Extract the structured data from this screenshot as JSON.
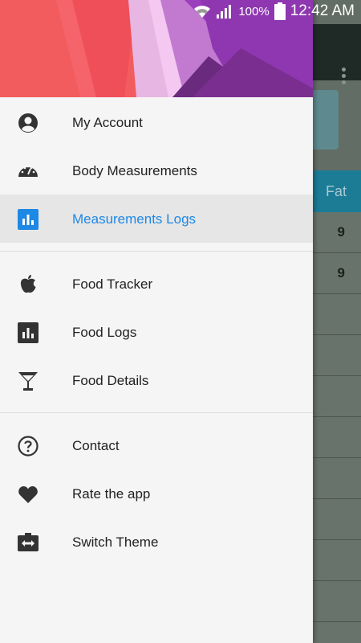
{
  "status_bar": {
    "battery_percent": "100%",
    "time": "12:42 AM"
  },
  "background": {
    "column_header": "Fat",
    "cell_values": [
      "9",
      "9"
    ]
  },
  "drawer": {
    "groups": [
      {
        "items": [
          {
            "label": "My Account",
            "icon": "account-circle-icon"
          },
          {
            "label": "Body Measurements",
            "icon": "speedometer-icon"
          },
          {
            "label": "Measurements Logs",
            "icon": "bar-chart-icon",
            "active": true
          }
        ]
      },
      {
        "items": [
          {
            "label": "Food Tracker",
            "icon": "apple-icon"
          },
          {
            "label": "Food Logs",
            "icon": "bar-chart-icon"
          },
          {
            "label": "Food Details",
            "icon": "cocktail-icon"
          }
        ]
      },
      {
        "items": [
          {
            "label": "Contact",
            "icon": "help-circle-icon"
          },
          {
            "label": "Rate the app",
            "icon": "heart-icon"
          },
          {
            "label": "Switch Theme",
            "icon": "switch-icon"
          }
        ]
      }
    ],
    "active_color": "#1e88e5"
  }
}
